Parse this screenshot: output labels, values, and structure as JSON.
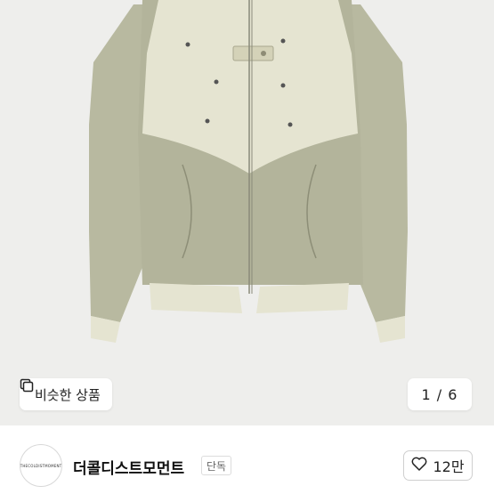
{
  "photo": {
    "icon": "product-photo-jacket",
    "similar_button": {
      "label": "비슷한 상품",
      "icon": "copy-icon"
    },
    "pagination": "1 / 6"
  },
  "seller": {
    "avatar_text": "THECOLDISTMOMENT",
    "name": "더콜디스트모먼트",
    "badge": "단독",
    "like": {
      "icon": "heart-icon",
      "count": "12만"
    }
  }
}
